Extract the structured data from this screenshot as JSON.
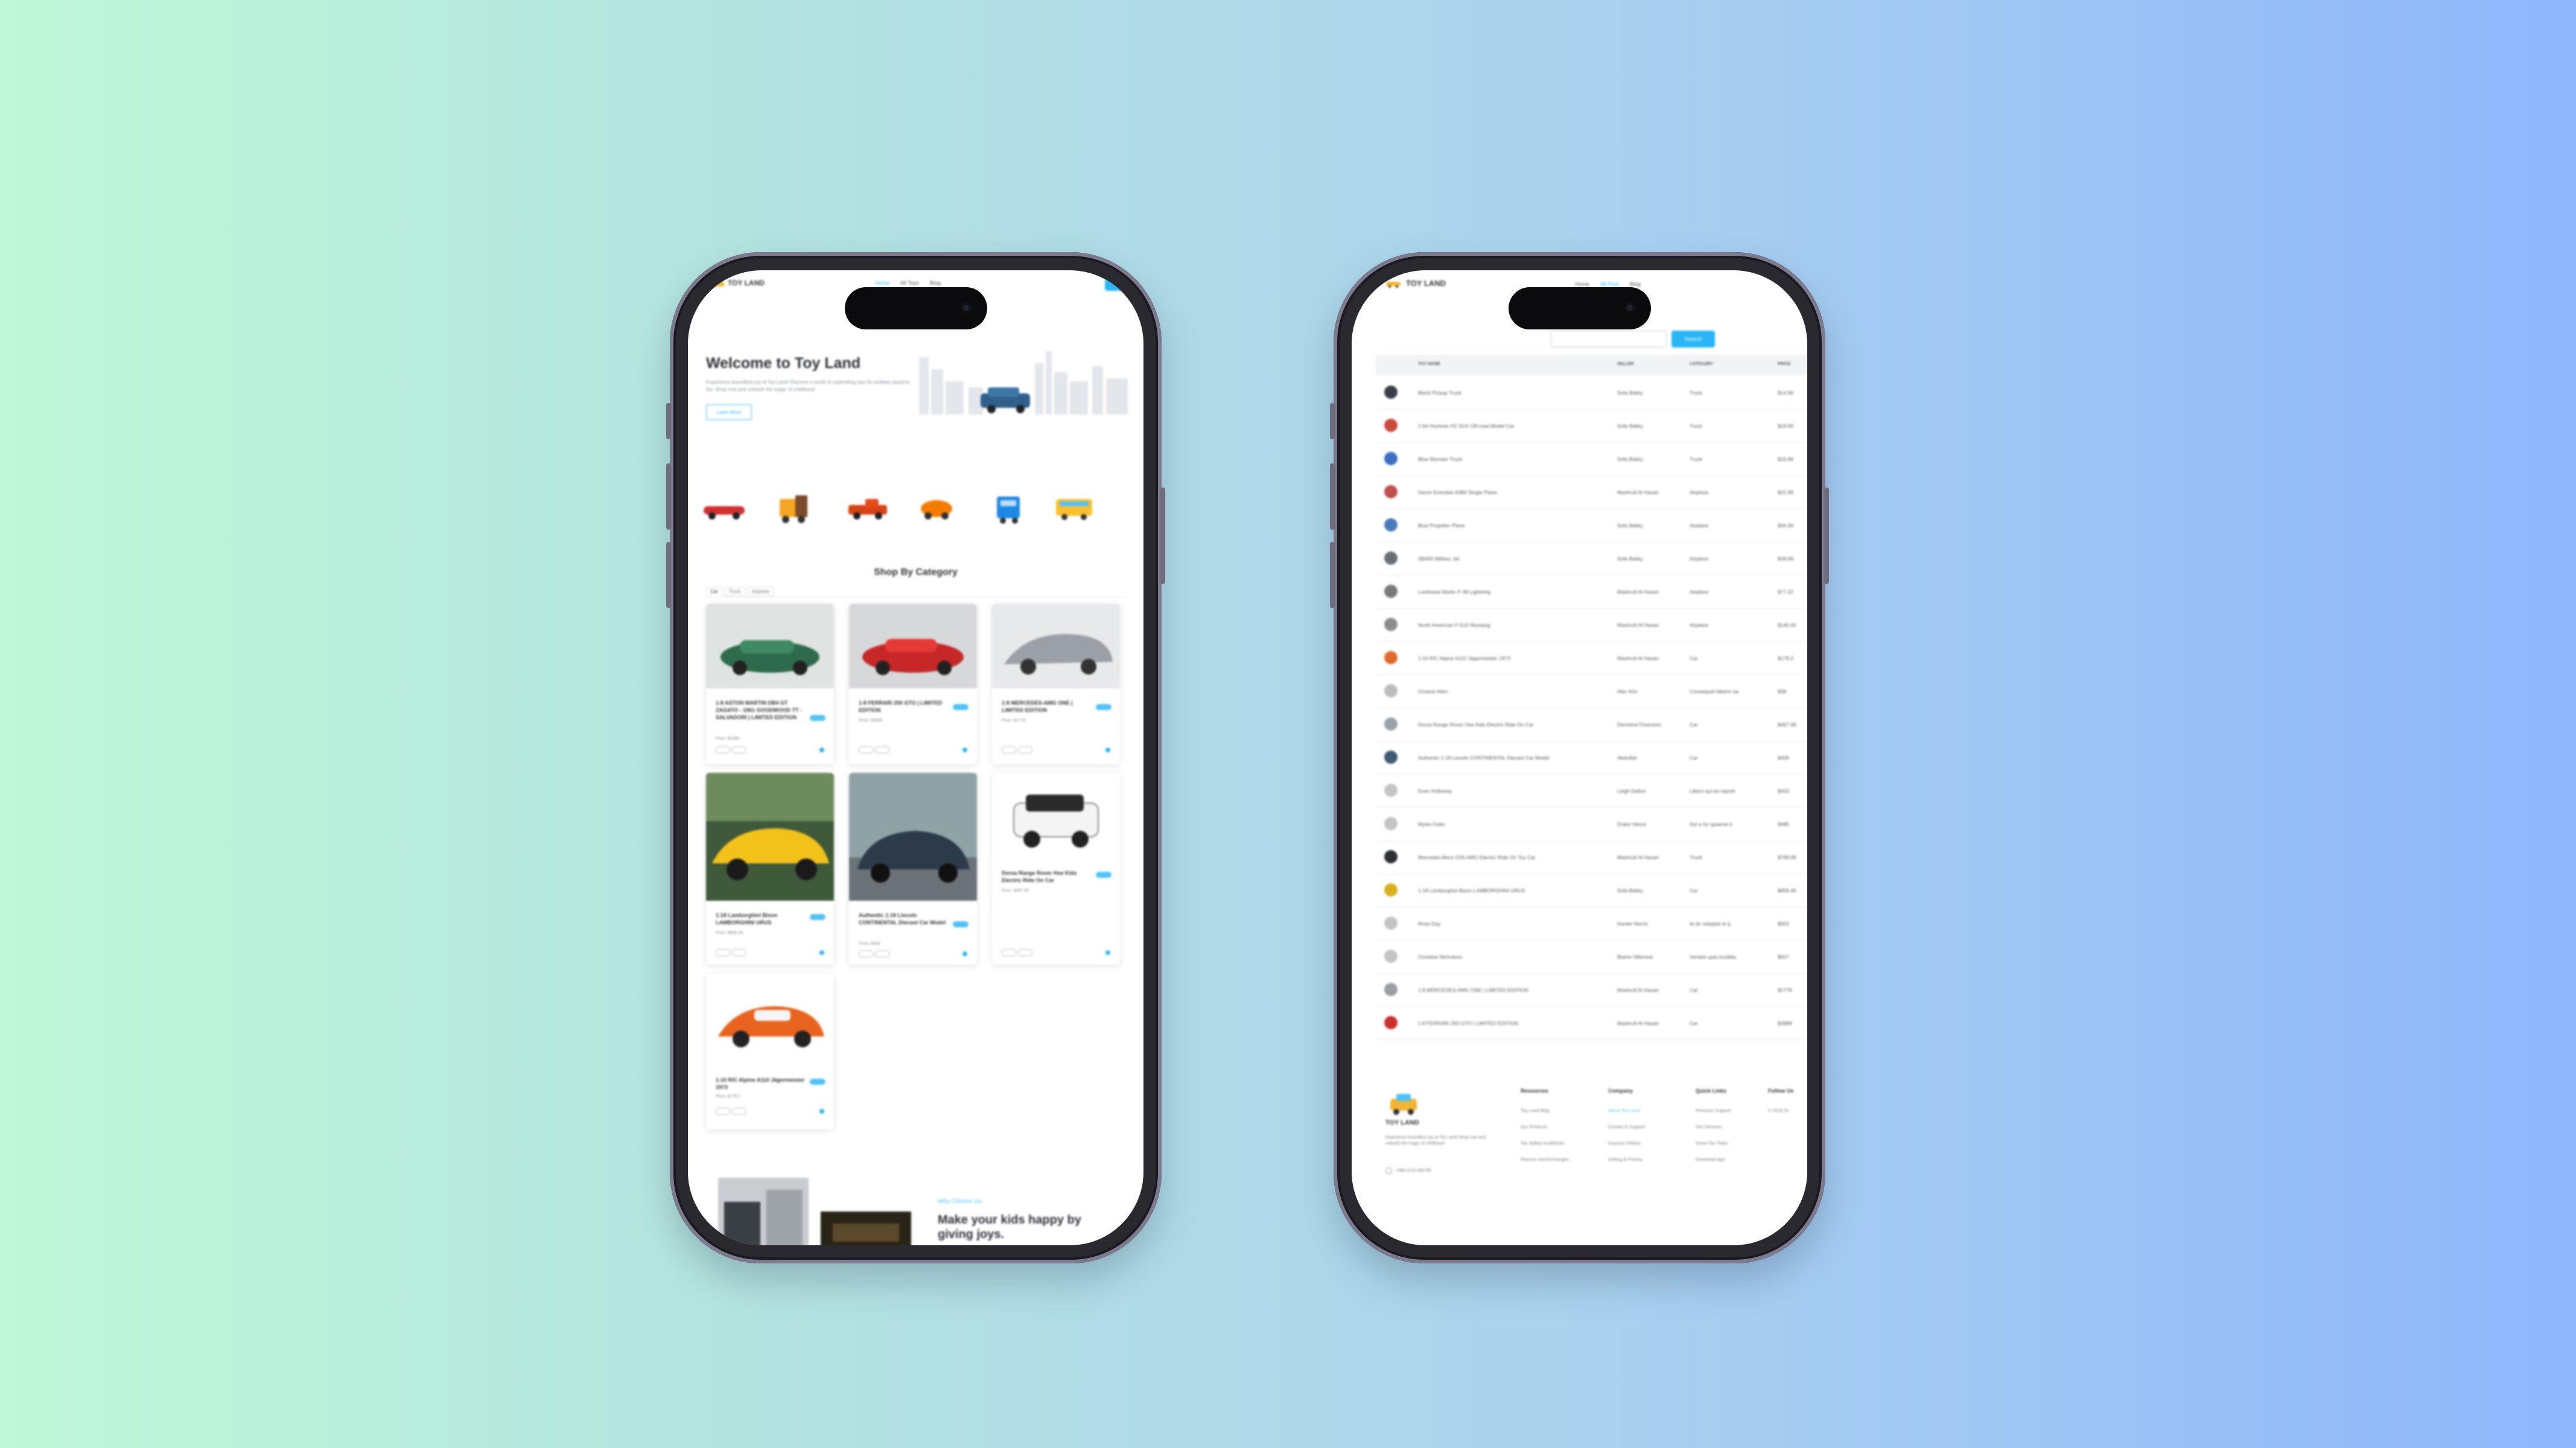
{
  "left_screen": {
    "brand": "TOY LAND",
    "nav": {
      "items": [
        "Home",
        "All Toys",
        "Blog"
      ],
      "active": 0
    },
    "hero": {
      "title": "Welcome to Toy Land",
      "subtitle": "Experience boundless joy at Toy Land! Discover a world of captivating toys for endless playtime fun. Shop now and unleash the magic of childhood!",
      "button": "Learn More"
    },
    "categories_title": "Shop By Category",
    "tabs": [
      "Car",
      "Truck",
      "Airplane"
    ],
    "products": [
      {
        "title": "1:8 ASTON MARTIN DB4 GT ZAGATO - 1961 GOODWOOD TT - SALVADORI | LIMITED EDITION",
        "price": "Price: $2988"
      },
      {
        "title": "1:8 FERRARI 250 GTO | LIMITED EDITION",
        "price": "Price: $3988"
      },
      {
        "title": "1:8 MERCEDES-AMG ONE | LIMITED EDITION",
        "price": "Price: $1778"
      },
      {
        "title": "1:18 Lamborghini Bison LAMBORGHINI URUS",
        "price": "Price: $856.45"
      },
      {
        "title": "Authentic 1:18 Lincoln CONTINENTAL Diecast Car Model",
        "price": "Price: $409"
      },
      {
        "title": "Dorsa Range Rover Hse Kids Electric Ride On Car",
        "price": "Price: $467.99"
      },
      {
        "title": "1:10 R/C Alpine A110 Jägermeister 1973",
        "price": "Price: $179.2"
      }
    ],
    "promo": {
      "kicker": "Why Choose Us",
      "title": "Make your kids happy by giving joys."
    }
  },
  "right_screen": {
    "brand": "TOY LAND",
    "nav": {
      "items": [
        "Home",
        "All Toys",
        "Blog"
      ],
      "active": 1
    },
    "search_button": "Search",
    "columns": [
      "TOY NAME",
      "SELLER",
      "CATEGORY",
      "PRICE"
    ],
    "rows": [
      {
        "name": "Black Pickup Truck",
        "seller": "Sofa Bakky",
        "category": "Truck",
        "price": "$14.99",
        "thumb": "#3a3f47"
      },
      {
        "name": "1:64 Hummer H2 SUV Off-road Model Car",
        "seller": "Sofa Bakky",
        "category": "Truck",
        "price": "$19.99",
        "thumb": "#c94a3c"
      },
      {
        "name": "Blue Monster Truck",
        "seller": "Sofa Bakky",
        "category": "Truck",
        "price": "$19.99",
        "thumb": "#3b6fc4"
      },
      {
        "name": "Daron Emirates A380 Single Plane",
        "seller": "Mashrufi Al Hasan",
        "category": "Airplane",
        "price": "$22.99",
        "thumb": "#c0504d"
      },
      {
        "name": "Blue Propeller Plane",
        "seller": "Sofa Bakky",
        "category": "Airplane",
        "price": "$34.99",
        "thumb": "#4a7ab8"
      },
      {
        "name": "SB400 Military Jet",
        "seller": "Sofa Bakky",
        "category": "Airplane",
        "price": "$39.99",
        "thumb": "#6a6f76"
      },
      {
        "name": "Lockheed Martin P-38 Lightning",
        "seller": "Mashrufi Al Hasan",
        "category": "Airplane",
        "price": "$77.22",
        "thumb": "#7a7a7a"
      },
      {
        "name": "North American F-51D Mustang",
        "seller": "Mashrufi Al Hasan",
        "category": "Airplane",
        "price": "$145.00",
        "thumb": "#8c8c8c"
      },
      {
        "name": "1:10 R/C Alpine A110 Jägermeister 1973",
        "seller": "Mashrufi Al Hasan",
        "category": "Car",
        "price": "$179.2",
        "thumb": "#e06a2b"
      },
      {
        "name": "Octavia Allen",
        "seller": "Alec Kim",
        "category": "Consequat hiberm ea",
        "price": "$38",
        "thumb": "#bdbdbd"
      },
      {
        "name": "Dorsa Range Rover Hse Kids Electric Ride On Car",
        "seller": "Demetrel Firstroom",
        "category": "Car",
        "price": "$467.99",
        "thumb": "#9aa2ab"
      },
      {
        "name": "Authentic 1:18 Lincoln CONTINENTAL Diecast Car Model",
        "seller": "Abdullah",
        "category": "Car",
        "price": "$409",
        "thumb": "#3f5a70"
      },
      {
        "name": "Evan Holloway",
        "seller": "Leigh Dalton",
        "category": "Libero qui ea repreh",
        "price": "$453",
        "thumb": "#c4c4c4"
      },
      {
        "name": "Myles Duke",
        "seller": "Drake Vance",
        "category": "Aut a fur quaerat d",
        "price": "$485",
        "thumb": "#c4c4c4"
      },
      {
        "name": "Mercedes-Benz G55 AMG Electric Ride On Toy Car",
        "seller": "Mashrufi Al Hasan",
        "category": "Truck",
        "price": "$799.99",
        "thumb": "#2d2f33"
      },
      {
        "name": "1:18 Lamborghini Bison LAMBORGHINI URUS",
        "seller": "Sofa Bakky",
        "category": "Car",
        "price": "$856.45",
        "thumb": "#d9b01c"
      },
      {
        "name": "Rose Day",
        "seller": "Hunter Norris",
        "category": "Id do voluptat et q",
        "price": "$923",
        "thumb": "#c4c4c4"
      },
      {
        "name": "Christine Nicholson",
        "seller": "Blaine Villarreal",
        "category": "Veniam quis incididu",
        "price": "$927",
        "thumb": "#c4c4c4"
      },
      {
        "name": "1:8 MERCEDES-AMG ONE | LIMITED EDITION",
        "seller": "Mashrufi Al Hasan",
        "category": "Car",
        "price": "$1778",
        "thumb": "#9b9ea3"
      },
      {
        "name": "1:8 FERRARI 250 GTO | LIMITED EDITION",
        "seller": "Mashrufi Al Hasan",
        "category": "Car",
        "price": "$3988",
        "thumb": "#c8302c"
      }
    ],
    "footer": {
      "brand": "TOY LAND",
      "description": "Experience boundless joy at Toy Land! Shop now and unleash the magic of childhood!",
      "phone": "+880 0123 456789",
      "columns": [
        {
          "title": "Resources",
          "links": [
            "Toy Land Blog",
            "Our Products",
            "Toy Safety Guidelines",
            "Returns and Exchanges"
          ],
          "highlight": -1
        },
        {
          "title": "Company",
          "links": [
            "About Toy Land",
            "Contact & Support",
            "Success History",
            "Setting & Privacy"
          ],
          "highlight": 0
        },
        {
          "title": "Quick Links",
          "links": [
            "Premium Support",
            "Our Services",
            "Know Our Team",
            "Download App"
          ],
          "highlight": -1
        },
        {
          "title": "Follow Us",
          "links": [
            "© 2023 To"
          ],
          "highlight": -1
        }
      ]
    }
  },
  "colors": {
    "accent": "#29b6f6",
    "background_left": "#bff7d8",
    "background_right": "#8fb6fb"
  }
}
